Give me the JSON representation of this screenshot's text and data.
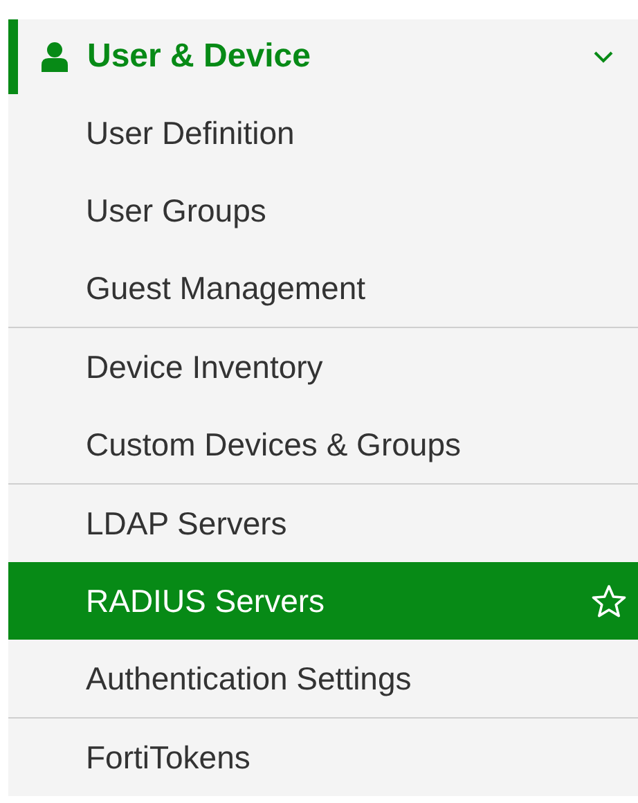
{
  "section": {
    "label": "User & Device",
    "expanded": true,
    "selected": true
  },
  "groups": [
    {
      "items": [
        {
          "label": "User Definition",
          "selected": false
        },
        {
          "label": "User Groups",
          "selected": false
        },
        {
          "label": "Guest Management",
          "selected": false
        }
      ]
    },
    {
      "items": [
        {
          "label": "Device Inventory",
          "selected": false
        },
        {
          "label": "Custom Devices & Groups",
          "selected": false
        }
      ]
    },
    {
      "items": [
        {
          "label": "LDAP Servers",
          "selected": false
        },
        {
          "label": "RADIUS Servers",
          "selected": true
        },
        {
          "label": "Authentication Settings",
          "selected": false
        }
      ]
    },
    {
      "items": [
        {
          "label": "FortiTokens",
          "selected": false
        }
      ]
    }
  ]
}
